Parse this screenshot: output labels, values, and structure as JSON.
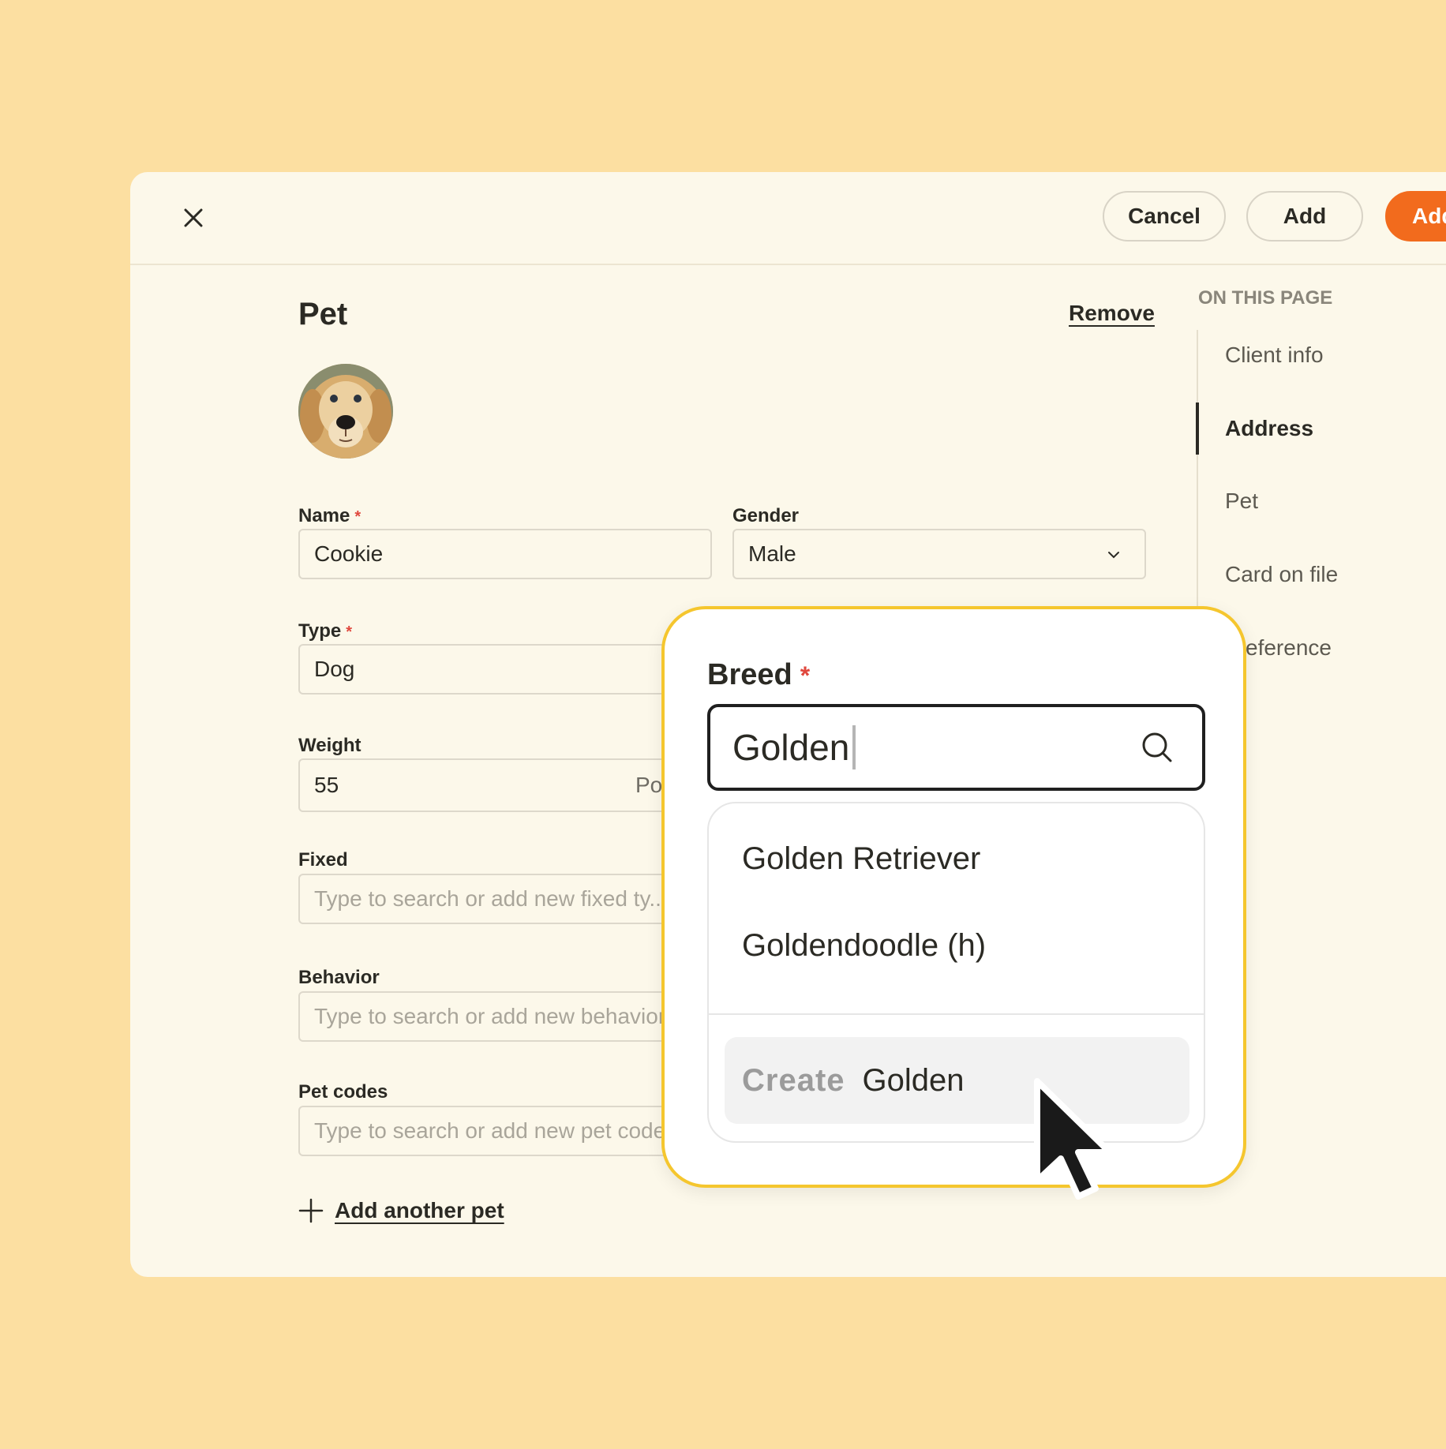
{
  "header": {
    "cancel_label": "Cancel",
    "add_label": "Add",
    "primary_label": "Add"
  },
  "pet_section": {
    "title": "Pet",
    "remove_label": "Remove",
    "required_mark": "*",
    "fields": {
      "name": {
        "label": "Name",
        "value": "Cookie"
      },
      "gender": {
        "label": "Gender",
        "value": "Male"
      },
      "type": {
        "label": "Type",
        "value": "Dog"
      },
      "weight": {
        "label": "Weight",
        "value": "55",
        "unit": "Pou"
      },
      "fixed": {
        "label": "Fixed",
        "placeholder": "Type to search or add new fixed ty..."
      },
      "behavior": {
        "label": "Behavior",
        "placeholder": "Type to search or add new behavior"
      },
      "pet_codes": {
        "label": "Pet codes",
        "placeholder": "Type to search or add new pet code"
      }
    },
    "add_another_label": "Add another pet"
  },
  "toc": {
    "heading": "ON THIS PAGE",
    "items": [
      "Client info",
      "Address",
      "Pet",
      "Card on file",
      "eference"
    ],
    "active_index": 1
  },
  "breed_popover": {
    "label": "Breed",
    "required_mark": "*",
    "query": "Golden",
    "results": [
      "Golden Retriever",
      "Goldendoodle (h)"
    ],
    "create_word": "Create",
    "create_term": "Golden"
  },
  "colors": {
    "background": "#FCDFA1",
    "card": "#FCF8EA",
    "accent": "#F26B1D",
    "popover_border": "#F5C62E",
    "required": "#E0483E"
  },
  "icons": [
    "close-icon",
    "chevron-down-icon",
    "plus-icon",
    "search-icon",
    "mouse-pointer-icon"
  ]
}
